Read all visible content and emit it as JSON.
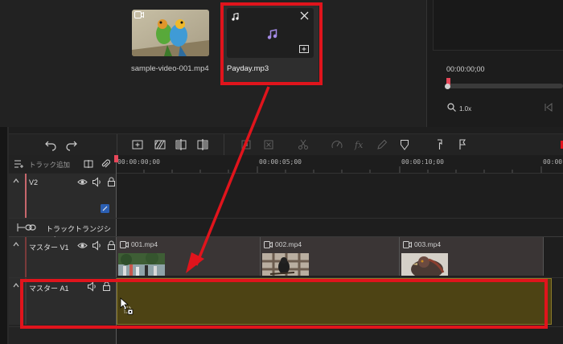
{
  "media": {
    "items": [
      {
        "name": "sample-video-001.mp4",
        "type_icon": "video-icon"
      },
      {
        "name": "Payday.mp3",
        "type_icon": "music-note-icon"
      }
    ]
  },
  "preview": {
    "timecode": "00:00:00;00",
    "zoom": "1.0x"
  },
  "timeline": {
    "add_track_label": "トラック追加",
    "ruler_ticks": [
      "00:00:00;00",
      "00:00:05;00",
      "00:00:10;00",
      "00:00:1"
    ],
    "tracks": [
      {
        "label": "V2"
      },
      {
        "label": "トラックトランジション"
      },
      {
        "label": "マスター V1"
      },
      {
        "label": "マスター A1"
      }
    ],
    "clips": [
      {
        "name": "001.mp4"
      },
      {
        "name": "002.mp4"
      },
      {
        "name": "003.mp4"
      }
    ]
  },
  "colors": {
    "highlight_red": "#e0141c",
    "audio_drop_zone": "#4d4314",
    "playhead": "#e8475a",
    "music_accent": "#a48ae6"
  }
}
